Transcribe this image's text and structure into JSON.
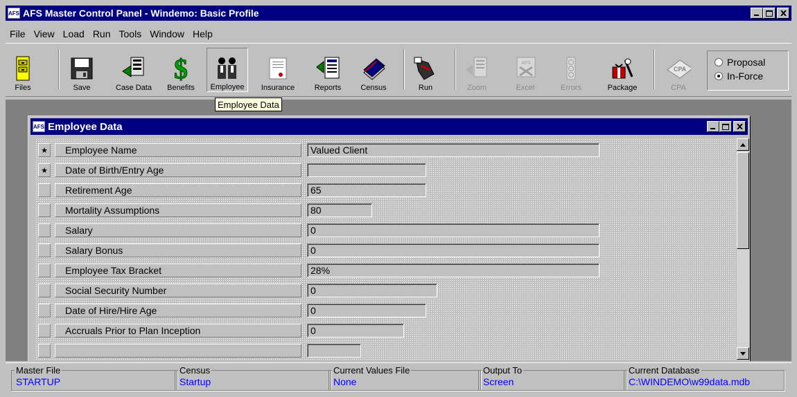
{
  "window": {
    "title": "AFS Master Control Panel - Windemo: Basic Profile",
    "icon_text": "AFS"
  },
  "menu": [
    "File",
    "View",
    "Load",
    "Run",
    "Tools",
    "Window",
    "Help"
  ],
  "toolbar": {
    "buttons": [
      {
        "label": "Files",
        "icon": "filing-cabinet-icon",
        "enabled": true
      },
      {
        "label": "Save",
        "icon": "floppy-disk-icon",
        "enabled": true
      },
      {
        "label": "Case Data",
        "icon": "case-data-icon",
        "enabled": true
      },
      {
        "label": "Benefits",
        "icon": "dollar-sign-icon",
        "enabled": true
      },
      {
        "label": "Employee",
        "icon": "people-icon",
        "enabled": true,
        "pressed": true
      },
      {
        "label": "Insurance",
        "icon": "certificate-icon",
        "enabled": true
      },
      {
        "label": "Reports",
        "icon": "reports-icon",
        "enabled": true
      },
      {
        "label": "Census",
        "icon": "card-stack-icon",
        "enabled": true
      },
      {
        "label": "Run",
        "icon": "run-icon",
        "enabled": true
      },
      {
        "label": "Zoom",
        "icon": "zoom-icon",
        "enabled": false
      },
      {
        "label": "Excel",
        "icon": "excel-icon",
        "enabled": false
      },
      {
        "label": "Errors",
        "icon": "traffic-light-icon",
        "enabled": false
      },
      {
        "label": "Package",
        "icon": "gift-package-icon",
        "enabled": true
      },
      {
        "label": "CPA",
        "icon": "cpa-icon",
        "enabled": false
      }
    ],
    "mode": {
      "options": [
        "Proposal",
        "In-Force"
      ],
      "selected": "In-Force"
    }
  },
  "tooltip": "Employee Data",
  "child": {
    "title": "Employee Data",
    "icon_text": "AFS",
    "rows": [
      {
        "label": "Employee Name",
        "value": "Valued Client",
        "required": true,
        "width": 422
      },
      {
        "label": "Date of Birth/Entry Age",
        "value": "",
        "required": true,
        "width": 172
      },
      {
        "label": "Retirement Age",
        "value": "65",
        "required": false,
        "width": 172
      },
      {
        "label": "Mortality Assumptions",
        "value": "80",
        "required": false,
        "width": 94
      },
      {
        "label": "Salary",
        "value": "0",
        "required": false,
        "width": 422
      },
      {
        "label": "Salary Bonus",
        "value": "0",
        "required": false,
        "width": 422
      },
      {
        "label": "Employee Tax Bracket",
        "value": "28%",
        "required": false,
        "width": 422
      },
      {
        "label": "Social Security Number",
        "value": "0",
        "required": false,
        "width": 188
      },
      {
        "label": "Date of Hire/Hire Age",
        "value": "0",
        "required": false,
        "width": 172
      },
      {
        "label": "Accruals Prior to Plan Inception",
        "value": "0",
        "required": false,
        "width": 140
      }
    ]
  },
  "status": [
    {
      "caption": "Master File",
      "value": "STARTUP"
    },
    {
      "caption": "Census",
      "value": "Startup"
    },
    {
      "caption": "Current Values File",
      "value": "None"
    },
    {
      "caption": "Output To",
      "value": "Screen"
    },
    {
      "caption": "Current Database",
      "value": "C:\\WINDEMO\\w99data.mdb"
    }
  ],
  "colors": {
    "title_bg": "#000080",
    "face": "#c0c0c0",
    "mdi_bg": "#808080",
    "status_value": "#0000ff",
    "tooltip_bg": "#ffffe1"
  }
}
